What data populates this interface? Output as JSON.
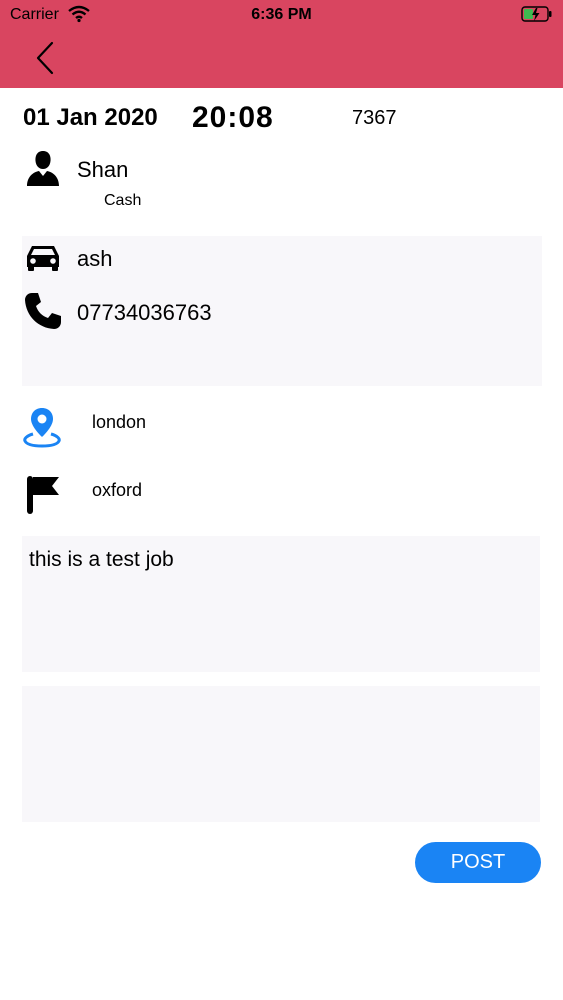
{
  "status_bar": {
    "carrier": "Carrier",
    "time": "6:36 PM",
    "icons": [
      "wifi-icon",
      "battery-charging-icon"
    ]
  },
  "header": {
    "background_color": "#d94560",
    "back_icon": "chevron-left-icon"
  },
  "job": {
    "date": "01 Jan 2020",
    "time": "20:08",
    "id": "7367"
  },
  "customer": {
    "name": "Shan",
    "payment": "Cash",
    "icon": "person-icon"
  },
  "details": {
    "vehicle": "ash",
    "vehicle_icon": "car-icon",
    "phone": "07734036763",
    "phone_icon": "phone-icon"
  },
  "route": {
    "pickup": "london",
    "pickup_icon": "location-pin-icon",
    "pickup_icon_color": "#1a84f4",
    "dropoff": "oxford",
    "dropoff_icon": "flag-icon"
  },
  "notes": {
    "text": "this is a test job"
  },
  "comment": {
    "value": ""
  },
  "actions": {
    "post_label": "POST",
    "post_color": "#1a84f4"
  }
}
